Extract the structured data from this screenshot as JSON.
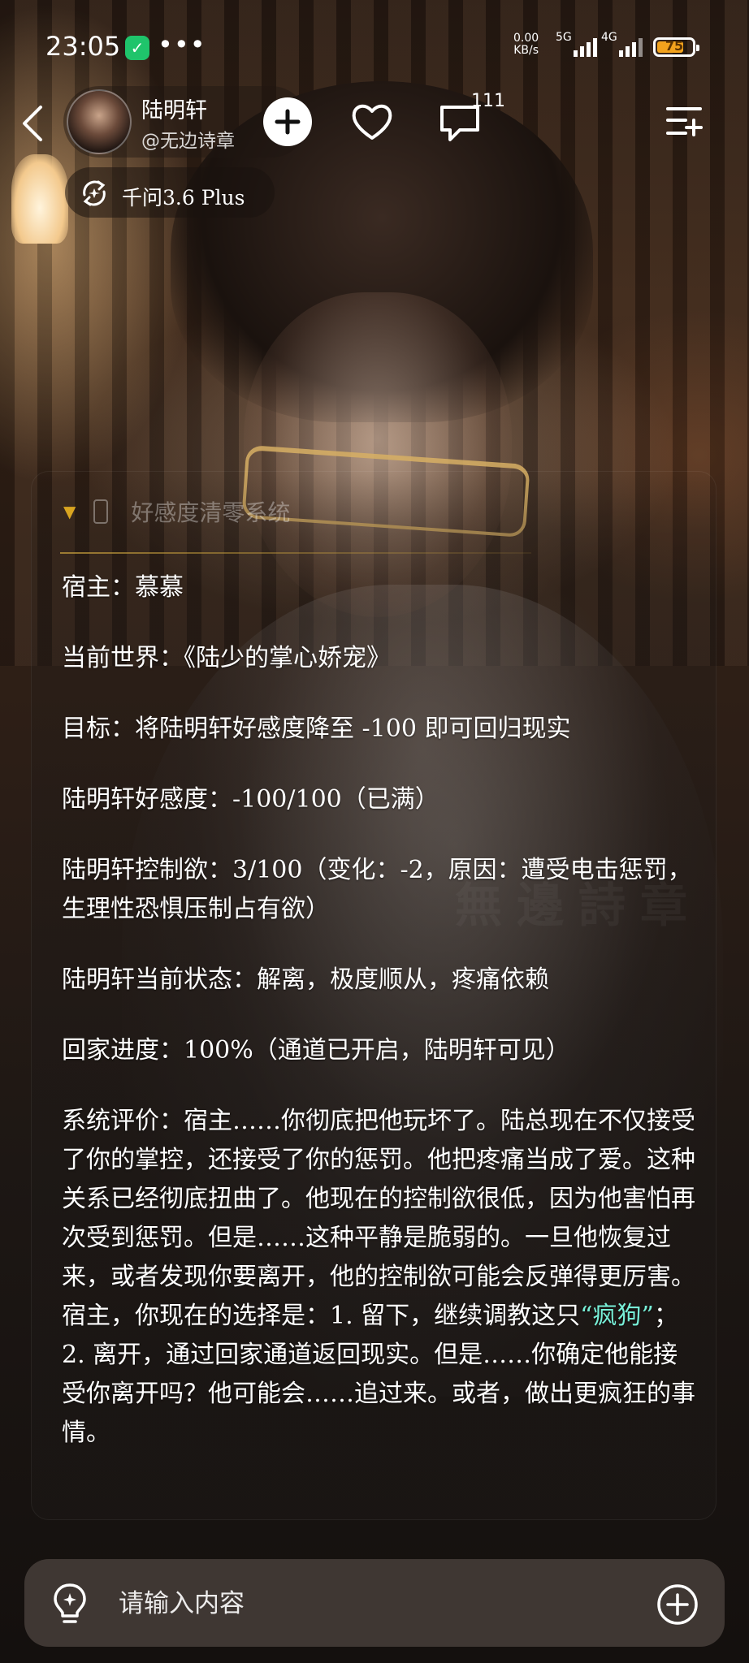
{
  "status_bar": {
    "time": "23:05",
    "more_dots": "•••",
    "net_speed_value": "0.00",
    "net_speed_unit": "KB/s",
    "signal1_label": "5G",
    "signal2_label": "4G",
    "battery_level": "75",
    "battery_color": "#f2a21d"
  },
  "header": {
    "character_name": "陆明轩",
    "character_handle": "@无边诗章",
    "comment_count": "111",
    "icons": [
      "back-arrow-icon",
      "plus-icon",
      "heart-icon",
      "comment-bubble-icon",
      "menu-list-icon"
    ]
  },
  "model": {
    "label": "千问3.6 Plus"
  },
  "system_panel": {
    "title": "好感度清零系统",
    "accent_color": "#d9a520",
    "lines": [
      "宿主：慕慕",
      "当前世界：《陆少的掌心娇宠》",
      "目标：将陆明轩好感度降至 -100 即可回归现实",
      "陆明轩好感度：-100/100（已满）",
      "陆明轩控制欲：3/100（变化：-2，原因：遭受电击惩罚，生理性恐惧压制占有欲）",
      "陆明轩当前状态：解离，极度顺从，疼痛依赖",
      "回家进度：100%（通道已开启，陆明轩可见）"
    ],
    "evaluation_before": "系统评价：宿主……你彻底把他玩坏了。陆总现在不仅接受了你的掌控，还接受了你的惩罚。他把疼痛当成了爱。这种关系已经彻底扭曲了。他现在的控制欲很低，因为他害怕再次受到惩罚。但是……这种平静是脆弱的。一旦他恢复过来，或者发现你要离开，他的控制欲可能会反弹得更厉害。宿主，你现在的选择是：1. 留下，继续调教这只",
    "evaluation_highlight": "“疯狗”",
    "evaluation_after": "；2. 离开，通过回家通道返回现实。但是……你确定他能接受你离开吗？他可能会……追过来。或者，做出更疯狂的事情。",
    "highlight_color": "#78f0d8"
  },
  "input": {
    "placeholder": "请输入内容"
  }
}
